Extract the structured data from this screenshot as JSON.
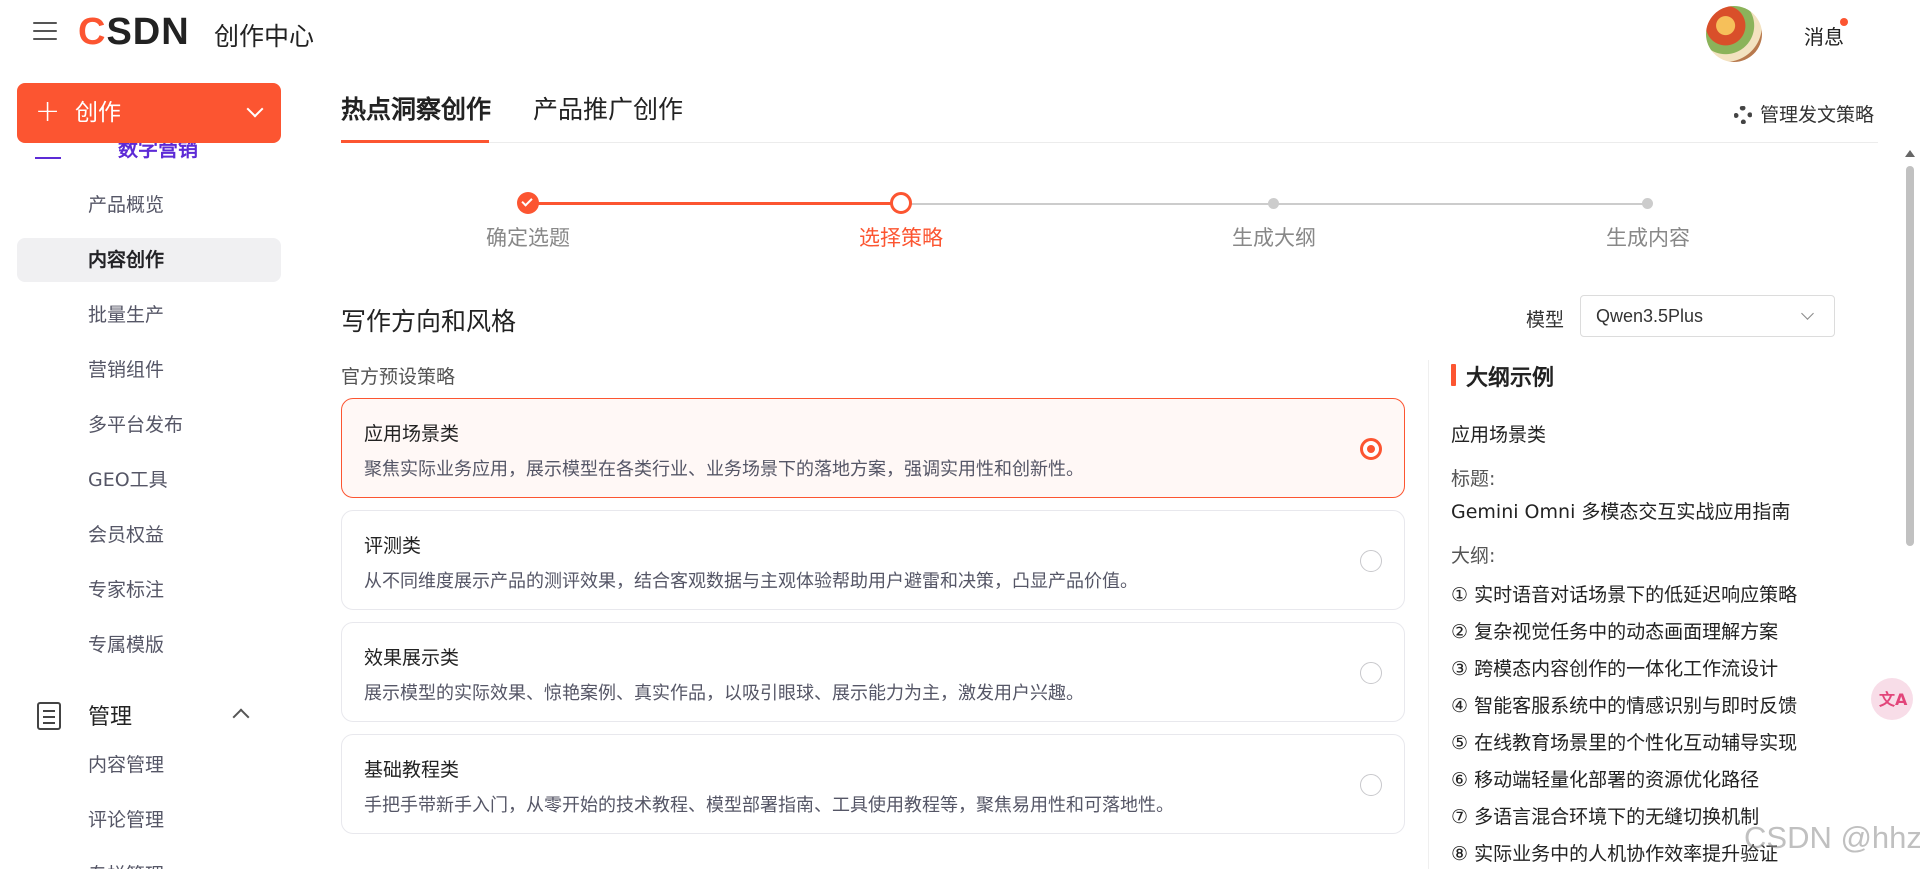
{
  "header": {
    "logo_c": "C",
    "logo_rest": "SDN",
    "app_title": "创作中心",
    "messages_label": "消息"
  },
  "sidebar": {
    "create_label": "创作",
    "cut_item_label": "数字营销",
    "items": [
      {
        "label": "产品概览",
        "active": false
      },
      {
        "label": "内容创作",
        "active": true
      },
      {
        "label": "批量生产",
        "active": false
      },
      {
        "label": "营销组件",
        "active": false
      },
      {
        "label": "多平台发布",
        "active": false
      },
      {
        "label": "GEO工具",
        "active": false
      },
      {
        "label": "会员权益",
        "active": false
      },
      {
        "label": "专家标注",
        "active": false
      },
      {
        "label": "专属模版",
        "active": false
      }
    ],
    "group_label": "管理",
    "group_items": [
      "内容管理",
      "评论管理",
      "专栏管理"
    ]
  },
  "tabs": [
    {
      "label": "热点洞察创作",
      "active": true
    },
    {
      "label": "产品推广创作",
      "active": false
    }
  ],
  "manage_strategy_label": "管理发文策略",
  "steps": [
    {
      "label": "确定选题",
      "state": "done"
    },
    {
      "label": "选择策略",
      "state": "current"
    },
    {
      "label": "生成大纲",
      "state": "pending"
    },
    {
      "label": "生成内容",
      "state": "pending"
    }
  ],
  "section_title": "写作方向和风格",
  "model": {
    "label": "模型",
    "value": "Qwen3.5Plus"
  },
  "preset_label": "官方预设策略",
  "strategies": [
    {
      "title": "应用场景类",
      "desc": "聚焦实际业务应用，展示模型在各类行业、业务场景下的落地方案，强调实用性和创新性。",
      "selected": true
    },
    {
      "title": "评测类",
      "desc": "从不同维度展示产品的测评效果，结合客观数据与主观体验帮助用户避雷和决策，凸显产品价值。",
      "selected": false
    },
    {
      "title": "效果展示类",
      "desc": "展示模型的实际效果、惊艳案例、真实作品，以吸引眼球、展示能力为主，激发用户兴趣。",
      "selected": false
    },
    {
      "title": "基础教程类",
      "desc": "手把手带新手入门，从零开始的技术教程、模型部署指南、工具使用教程等，聚焦易用性和可落地性。",
      "selected": false
    }
  ],
  "outline": {
    "title": "大纲示例",
    "category": "应用场景类",
    "title_label": "标题:",
    "title_value": "Gemini Omni 多模态交互实战应用指南",
    "outline_label": "大纲:",
    "items": [
      "① 实时语音对话场景下的低延迟响应策略",
      "② 复杂视觉任务中的动态画面理解方案",
      "③ 跨模态内容创作的一体化工作流设计",
      "④ 智能客服系统中的情感识别与即时反馈",
      "⑤ 在线教育场景里的个性化互动辅导实现",
      "⑥ 移动端轻量化部署的资源优化路径",
      "⑦ 多语言混合环境下的无缝切换机制",
      "⑧ 实际业务中的人机协作效率提升验证"
    ]
  },
  "float_button_label": "文A",
  "watermark": "CSDN @hhzz",
  "colors": {
    "accent": "#fc5531",
    "pending": "#cccccc"
  }
}
